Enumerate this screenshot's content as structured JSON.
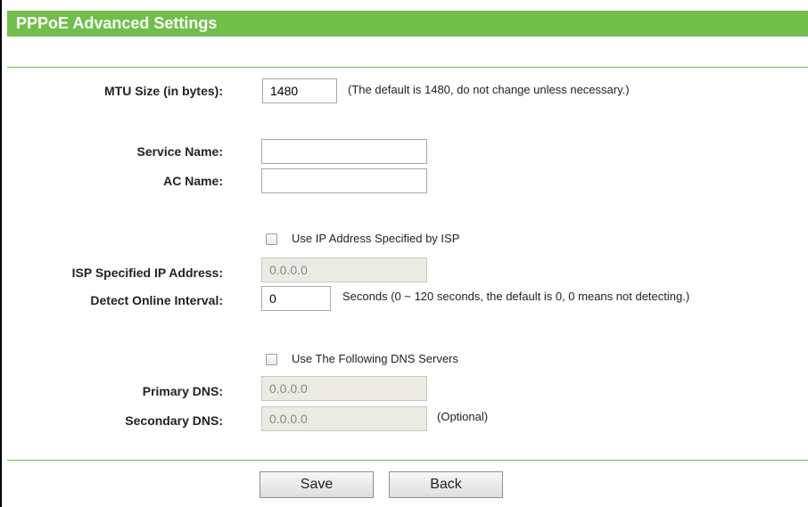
{
  "header": {
    "title": "PPPoE Advanced Settings"
  },
  "form": {
    "mtu": {
      "label": "MTU Size (in bytes):",
      "value": "1480",
      "hint": "(The default is 1480, do not change unless necessary.)"
    },
    "service_name": {
      "label": "Service Name:",
      "value": ""
    },
    "ac_name": {
      "label": "AC Name:",
      "value": ""
    },
    "use_isp_ip": {
      "label": "Use IP Address Specified by ISP",
      "checked": false
    },
    "isp_ip": {
      "label": "ISP Specified IP Address:",
      "value": "0.0.0.0"
    },
    "detect_interval": {
      "label": "Detect Online Interval:",
      "value": "0",
      "hint": "Seconds (0 ~ 120 seconds, the default is 0, 0 means not detecting.)"
    },
    "use_dns": {
      "label": "Use The Following DNS Servers",
      "checked": false
    },
    "primary_dns": {
      "label": "Primary DNS:",
      "value": "0.0.0.0"
    },
    "secondary_dns": {
      "label": "Secondary DNS:",
      "value": "0.0.0.0",
      "hint": "(Optional)"
    }
  },
  "buttons": {
    "save": "Save",
    "back": "Back"
  },
  "colors": {
    "accent": "#6fbf4a",
    "disabled_field": "#ebebe4"
  }
}
